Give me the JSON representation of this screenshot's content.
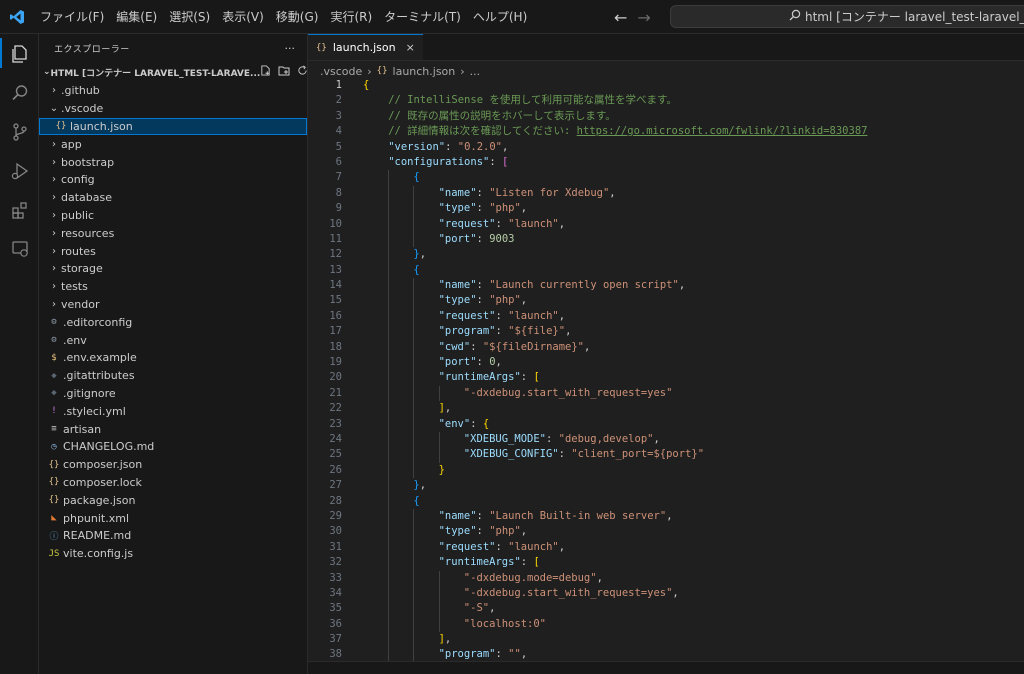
{
  "menu": [
    "ファイル(F)",
    "編集(E)",
    "選択(S)",
    "表示(V)",
    "移動(G)",
    "実行(R)",
    "ターミナル(T)",
    "ヘルプ(H)"
  ],
  "command_center": "html [コンテナー laravel_test-laravel_app (lara",
  "activity_icons": [
    "explorer-icon",
    "search-icon",
    "source-control-icon",
    "run-debug-icon",
    "extensions-icon",
    "remote-explorer-icon"
  ],
  "sidebar": {
    "title": "エクスプローラー",
    "more": "···",
    "section_title": "HTML [コンテナー LARAVEL_TEST-LARAVE...",
    "tree": [
      {
        "label": ".github",
        "kind": "folder",
        "indent": 1,
        "twisty": "›",
        "icon": ""
      },
      {
        "label": ".vscode",
        "kind": "folder",
        "indent": 1,
        "twisty": "⌄",
        "icon": ""
      },
      {
        "label": "launch.json",
        "kind": "json",
        "indent": 2,
        "twisty": "",
        "icon": "{}",
        "color": "#e2c08d",
        "selected": true
      },
      {
        "label": "app",
        "kind": "folder",
        "indent": 1,
        "twisty": "›",
        "icon": ""
      },
      {
        "label": "bootstrap",
        "kind": "folder",
        "indent": 1,
        "twisty": "›",
        "icon": ""
      },
      {
        "label": "config",
        "kind": "folder",
        "indent": 1,
        "twisty": "›",
        "icon": ""
      },
      {
        "label": "database",
        "kind": "folder",
        "indent": 1,
        "twisty": "›",
        "icon": ""
      },
      {
        "label": "public",
        "kind": "folder",
        "indent": 1,
        "twisty": "›",
        "icon": ""
      },
      {
        "label": "resources",
        "kind": "folder",
        "indent": 1,
        "twisty": "›",
        "icon": ""
      },
      {
        "label": "routes",
        "kind": "folder",
        "indent": 1,
        "twisty": "›",
        "icon": ""
      },
      {
        "label": "storage",
        "kind": "folder",
        "indent": 1,
        "twisty": "›",
        "icon": ""
      },
      {
        "label": "tests",
        "kind": "folder",
        "indent": 1,
        "twisty": "›",
        "icon": ""
      },
      {
        "label": "vendor",
        "kind": "folder",
        "indent": 1,
        "twisty": "›",
        "icon": ""
      },
      {
        "label": ".editorconfig",
        "kind": "gear",
        "indent": 1,
        "twisty": "",
        "icon": "⚙",
        "color": "#8d9aa7"
      },
      {
        "label": ".env",
        "kind": "gear",
        "indent": 1,
        "twisty": "",
        "icon": "⚙",
        "color": "#8d9aa7"
      },
      {
        "label": ".env.example",
        "kind": "dollar",
        "indent": 1,
        "twisty": "",
        "icon": "$",
        "color": "#e5c07b"
      },
      {
        "label": ".gitattributes",
        "kind": "git",
        "indent": 1,
        "twisty": "",
        "icon": "◆",
        "color": "#5b6670"
      },
      {
        "label": ".gitignore",
        "kind": "git",
        "indent": 1,
        "twisty": "",
        "icon": "◆",
        "color": "#5b6670"
      },
      {
        "label": ".styleci.yml",
        "kind": "yaml",
        "indent": 1,
        "twisty": "",
        "icon": "!",
        "color": "#c678dd"
      },
      {
        "label": "artisan",
        "kind": "text",
        "indent": 1,
        "twisty": "",
        "icon": "≡",
        "color": "#cccccc"
      },
      {
        "label": "CHANGELOG.md",
        "kind": "changelog",
        "indent": 1,
        "twisty": "",
        "icon": "◷",
        "color": "#8db8e0"
      },
      {
        "label": "composer.json",
        "kind": "json",
        "indent": 1,
        "twisty": "",
        "icon": "{}",
        "color": "#e2c08d"
      },
      {
        "label": "composer.lock",
        "kind": "json",
        "indent": 1,
        "twisty": "",
        "icon": "{}",
        "color": "#e2c08d"
      },
      {
        "label": "package.json",
        "kind": "json",
        "indent": 1,
        "twisty": "",
        "icon": "{}",
        "color": "#e2c08d"
      },
      {
        "label": "phpunit.xml",
        "kind": "xml",
        "indent": 1,
        "twisty": "",
        "icon": "◣",
        "color": "#e37933"
      },
      {
        "label": "README.md",
        "kind": "info",
        "indent": 1,
        "twisty": "",
        "icon": "ⓘ",
        "color": "#519aba"
      },
      {
        "label": "vite.config.js",
        "kind": "js",
        "indent": 1,
        "twisty": "",
        "icon": "JS",
        "color": "#cbcb41"
      }
    ]
  },
  "tab": {
    "label": "launch.json",
    "icon": "{}",
    "close": "×"
  },
  "breadcrumb": [
    ".vscode",
    "›",
    "{}",
    "launch.json",
    "›",
    "..."
  ],
  "current_line": 1,
  "code": [
    {
      "n": 1,
      "i": 0,
      "t": [
        [
          "{",
          "b1"
        ]
      ]
    },
    {
      "n": 2,
      "i": 1,
      "t": [
        [
          "// IntelliSense を使用して利用可能な属性を学べます。",
          "c"
        ]
      ]
    },
    {
      "n": 3,
      "i": 1,
      "t": [
        [
          "// 既存の属性の説明をホバーして表示します。",
          "c"
        ]
      ]
    },
    {
      "n": 4,
      "i": 1,
      "t": [
        [
          "// 詳細情報は次を確認してください: ",
          "c"
        ],
        [
          "https://go.microsoft.com/fwlink/?linkid=830387",
          "u"
        ]
      ]
    },
    {
      "n": 5,
      "i": 1,
      "t": [
        [
          "\"version\"",
          "k"
        ],
        [
          ": ",
          "p"
        ],
        [
          "\"0.2.0\"",
          "s"
        ],
        [
          ",",
          "p"
        ]
      ]
    },
    {
      "n": 6,
      "i": 1,
      "t": [
        [
          "\"configurations\"",
          "k"
        ],
        [
          ": ",
          "p"
        ],
        [
          "[",
          "b2"
        ]
      ]
    },
    {
      "n": 7,
      "i": 2,
      "t": [
        [
          "{",
          "b3"
        ]
      ]
    },
    {
      "n": 8,
      "i": 3,
      "t": [
        [
          "\"name\"",
          "k"
        ],
        [
          ": ",
          "p"
        ],
        [
          "\"Listen for Xdebug\"",
          "s"
        ],
        [
          ",",
          "p"
        ]
      ]
    },
    {
      "n": 9,
      "i": 3,
      "t": [
        [
          "\"type\"",
          "k"
        ],
        [
          ": ",
          "p"
        ],
        [
          "\"php\"",
          "s"
        ],
        [
          ",",
          "p"
        ]
      ]
    },
    {
      "n": 10,
      "i": 3,
      "t": [
        [
          "\"request\"",
          "k"
        ],
        [
          ": ",
          "p"
        ],
        [
          "\"launch\"",
          "s"
        ],
        [
          ",",
          "p"
        ]
      ]
    },
    {
      "n": 11,
      "i": 3,
      "t": [
        [
          "\"port\"",
          "k"
        ],
        [
          ": ",
          "p"
        ],
        [
          "9003",
          "n"
        ]
      ]
    },
    {
      "n": 12,
      "i": 2,
      "t": [
        [
          "}",
          "b3"
        ],
        [
          ",",
          "p"
        ]
      ]
    },
    {
      "n": 13,
      "i": 2,
      "t": [
        [
          "{",
          "b3"
        ]
      ]
    },
    {
      "n": 14,
      "i": 3,
      "t": [
        [
          "\"name\"",
          "k"
        ],
        [
          ": ",
          "p"
        ],
        [
          "\"Launch currently open script\"",
          "s"
        ],
        [
          ",",
          "p"
        ]
      ]
    },
    {
      "n": 15,
      "i": 3,
      "t": [
        [
          "\"type\"",
          "k"
        ],
        [
          ": ",
          "p"
        ],
        [
          "\"php\"",
          "s"
        ],
        [
          ",",
          "p"
        ]
      ]
    },
    {
      "n": 16,
      "i": 3,
      "t": [
        [
          "\"request\"",
          "k"
        ],
        [
          ": ",
          "p"
        ],
        [
          "\"launch\"",
          "s"
        ],
        [
          ",",
          "p"
        ]
      ]
    },
    {
      "n": 17,
      "i": 3,
      "t": [
        [
          "\"program\"",
          "k"
        ],
        [
          ": ",
          "p"
        ],
        [
          "\"${file}\"",
          "s"
        ],
        [
          ",",
          "p"
        ]
      ]
    },
    {
      "n": 18,
      "i": 3,
      "t": [
        [
          "\"cwd\"",
          "k"
        ],
        [
          ": ",
          "p"
        ],
        [
          "\"${fileDirname}\"",
          "s"
        ],
        [
          ",",
          "p"
        ]
      ]
    },
    {
      "n": 19,
      "i": 3,
      "t": [
        [
          "\"port\"",
          "k"
        ],
        [
          ": ",
          "p"
        ],
        [
          "0",
          "n"
        ],
        [
          ",",
          "p"
        ]
      ]
    },
    {
      "n": 20,
      "i": 3,
      "t": [
        [
          "\"runtimeArgs\"",
          "k"
        ],
        [
          ": ",
          "p"
        ],
        [
          "[",
          "b1"
        ]
      ]
    },
    {
      "n": 21,
      "i": 4,
      "t": [
        [
          "\"-dxdebug.start_with_request=yes\"",
          "s"
        ]
      ]
    },
    {
      "n": 22,
      "i": 3,
      "t": [
        [
          "]",
          "b1"
        ],
        [
          ",",
          "p"
        ]
      ]
    },
    {
      "n": 23,
      "i": 3,
      "t": [
        [
          "\"env\"",
          "k"
        ],
        [
          ": ",
          "p"
        ],
        [
          "{",
          "b1"
        ]
      ]
    },
    {
      "n": 24,
      "i": 4,
      "t": [
        [
          "\"XDEBUG_MODE\"",
          "k"
        ],
        [
          ": ",
          "p"
        ],
        [
          "\"debug,develop\"",
          "s"
        ],
        [
          ",",
          "p"
        ]
      ]
    },
    {
      "n": 25,
      "i": 4,
      "t": [
        [
          "\"XDEBUG_CONFIG\"",
          "k"
        ],
        [
          ": ",
          "p"
        ],
        [
          "\"client_port=${port}\"",
          "s"
        ]
      ]
    },
    {
      "n": 26,
      "i": 3,
      "t": [
        [
          "}",
          "b1"
        ]
      ]
    },
    {
      "n": 27,
      "i": 2,
      "t": [
        [
          "}",
          "b3"
        ],
        [
          ",",
          "p"
        ]
      ]
    },
    {
      "n": 28,
      "i": 2,
      "t": [
        [
          "{",
          "b3"
        ]
      ]
    },
    {
      "n": 29,
      "i": 3,
      "t": [
        [
          "\"name\"",
          "k"
        ],
        [
          ": ",
          "p"
        ],
        [
          "\"Launch Built-in web server\"",
          "s"
        ],
        [
          ",",
          "p"
        ]
      ]
    },
    {
      "n": 30,
      "i": 3,
      "t": [
        [
          "\"type\"",
          "k"
        ],
        [
          ": ",
          "p"
        ],
        [
          "\"php\"",
          "s"
        ],
        [
          ",",
          "p"
        ]
      ]
    },
    {
      "n": 31,
      "i": 3,
      "t": [
        [
          "\"request\"",
          "k"
        ],
        [
          ": ",
          "p"
        ],
        [
          "\"launch\"",
          "s"
        ],
        [
          ",",
          "p"
        ]
      ]
    },
    {
      "n": 32,
      "i": 3,
      "t": [
        [
          "\"runtimeArgs\"",
          "k"
        ],
        [
          ": ",
          "p"
        ],
        [
          "[",
          "b1"
        ]
      ]
    },
    {
      "n": 33,
      "i": 4,
      "t": [
        [
          "\"-dxdebug.mode=debug\"",
          "s"
        ],
        [
          ",",
          "p"
        ]
      ]
    },
    {
      "n": 34,
      "i": 4,
      "t": [
        [
          "\"-dxdebug.start_with_request=yes\"",
          "s"
        ],
        [
          ",",
          "p"
        ]
      ]
    },
    {
      "n": 35,
      "i": 4,
      "t": [
        [
          "\"-S\"",
          "s"
        ],
        [
          ",",
          "p"
        ]
      ]
    },
    {
      "n": 36,
      "i": 4,
      "t": [
        [
          "\"localhost:0\"",
          "s"
        ]
      ]
    },
    {
      "n": 37,
      "i": 3,
      "t": [
        [
          "]",
          "b1"
        ],
        [
          ",",
          "p"
        ]
      ]
    },
    {
      "n": 38,
      "i": 3,
      "t": [
        [
          "\"program\"",
          "k"
        ],
        [
          ": ",
          "p"
        ],
        [
          "\"\"",
          "s"
        ],
        [
          ",",
          "p"
        ]
      ]
    }
  ],
  "colors": {
    "accent": "#0078d4",
    "selection": "#04395e",
    "editor_bg": "#1f1f1f",
    "chrome_bg": "#181818"
  }
}
